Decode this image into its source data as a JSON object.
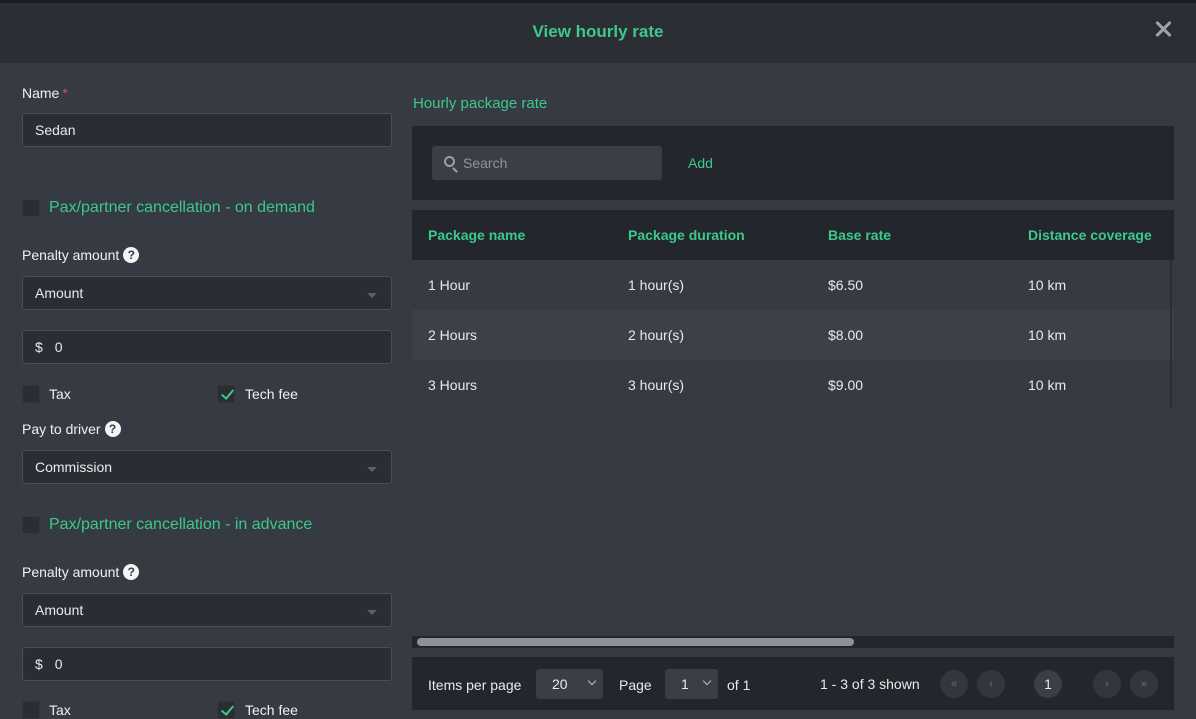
{
  "dialog": {
    "title": "View hourly rate"
  },
  "form": {
    "name_label": "Name",
    "required_mark": "*",
    "name_value": "Sedan",
    "on_demand": {
      "title": "Pax/partner cancellation - on demand",
      "checked": false,
      "penalty_label": "Penalty amount",
      "penalty_type": "Amount",
      "currency_symbol": "$",
      "amount_value": "0",
      "tax_label": "Tax",
      "tax_checked": false,
      "tech_fee_label": "Tech fee",
      "tech_fee_checked": true,
      "pay_to_driver_label": "Pay to driver",
      "pay_to_driver_value": "Commission"
    },
    "in_advance": {
      "title": "Pax/partner cancellation - in advance",
      "checked": false,
      "penalty_label": "Penalty amount",
      "penalty_type": "Amount",
      "currency_symbol": "$",
      "amount_value": "0",
      "tax_label": "Tax",
      "tax_checked": false,
      "tech_fee_label": "Tech fee",
      "tech_fee_checked": true
    }
  },
  "package_panel": {
    "title": "Hourly package rate",
    "search_placeholder": "Search",
    "add_label": "Add",
    "columns": [
      "Package name",
      "Package duration",
      "Base rate",
      "Distance coverage"
    ],
    "rows": [
      [
        "1 Hour",
        "1 hour(s)",
        "$6.50",
        "10 km"
      ],
      [
        "2 Hours",
        "2 hour(s)",
        "$8.00",
        "10 km"
      ],
      [
        "3 Hours",
        "3 hour(s)",
        "$9.00",
        "10 km"
      ]
    ]
  },
  "pagination": {
    "items_per_page_label": "Items per page",
    "items_per_page_value": "20",
    "page_label": "Page",
    "page_value": "1",
    "of_label": "of 1",
    "shown_text": "1 - 3 of 3 shown",
    "first_symbol": "«",
    "prev_symbol": "‹",
    "current_page": "1",
    "next_symbol": "›",
    "last_symbol": "»"
  },
  "colors": {
    "accent": "#3cc98b",
    "background": "#363a43",
    "header": "#2b2e35",
    "required": "#e0494e"
  }
}
